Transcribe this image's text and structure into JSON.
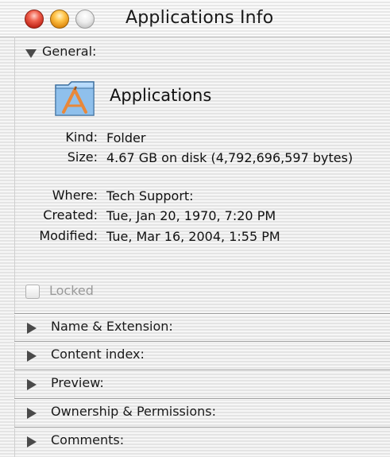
{
  "window": {
    "title": "Applications Info"
  },
  "general": {
    "header": "General:",
    "name": "Applications",
    "icon": "applications-folder-icon",
    "fields": [
      {
        "label": "Kind:",
        "value": "Folder"
      },
      {
        "label": "Size:",
        "value": "4.67 GB on disk (4,792,696,597 bytes)"
      },
      {
        "label": "Where:",
        "value": "Tech Support:"
      },
      {
        "label": "Created:",
        "value": "Tue, Jan 20, 1970, 7:20 PM"
      },
      {
        "label": "Modified:",
        "value": "Tue, Mar 16, 2004, 1:55 PM"
      }
    ],
    "locked": {
      "label": "Locked",
      "checked": false
    }
  },
  "sections": [
    {
      "label": "Name & Extension:",
      "expanded": false
    },
    {
      "label": "Content index:",
      "expanded": false
    },
    {
      "label": "Preview:",
      "expanded": false
    },
    {
      "label": "Ownership & Permissions:",
      "expanded": false
    },
    {
      "label": "Comments:",
      "expanded": false
    }
  ],
  "colors": {
    "close": "#e0473a",
    "minimize": "#f5b12e",
    "zoom": "#d8d8d8"
  }
}
